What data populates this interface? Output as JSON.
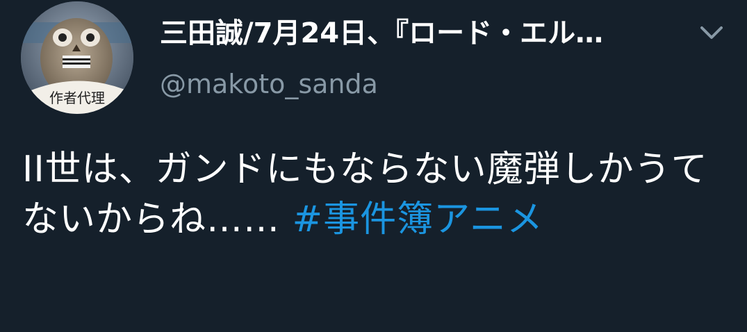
{
  "user": {
    "display_name": "三田誠/7月24日、『ロード・エル…",
    "handle": "@makoto_sanda",
    "avatar_caption": "作者代理"
  },
  "tweet": {
    "text": "II世は、ガンドにもならない魔弾しかうてないからね…… ",
    "hashtag": "#事件簿アニメ"
  },
  "icons": {
    "menu": "chevron-down-icon"
  },
  "colors": {
    "background": "#15202b",
    "text": "#ffffff",
    "secondary": "#8899a6",
    "link": "#1b95e0"
  }
}
